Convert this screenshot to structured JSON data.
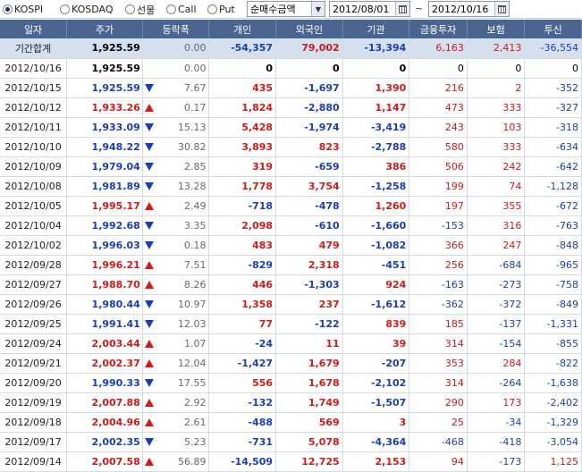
{
  "toolbar": {
    "radios": [
      {
        "label": "KOSPI",
        "selected": true
      },
      {
        "label": "KOSDAQ",
        "selected": false
      },
      {
        "label": "선물",
        "selected": false
      },
      {
        "label": "Call",
        "selected": false
      },
      {
        "label": "Put",
        "selected": false
      }
    ],
    "metric_select": "순매수금액",
    "start_date": "2012/08/01",
    "range_separator": "~",
    "end_date": "2012/10/16"
  },
  "columns": [
    "일자",
    "주가",
    "등락폭",
    "개인",
    "외국인",
    "기관",
    "금융투자",
    "보험",
    "투신"
  ],
  "colors": {
    "up": "#d11a1a",
    "down": "#1b3fb0",
    "header_bg": "#4a6590",
    "summary_bg": "#d5e0ef"
  },
  "rows": [
    {
      "date": "기간합계",
      "price": "1,925.59",
      "dir": "none",
      "change": "0.00",
      "individual": "-54,357",
      "foreign": "79,002",
      "institution": "-13,394",
      "fin_invest": "6,163",
      "insurance": "2,413",
      "trust": "-36,554",
      "summary": true
    },
    {
      "date": "2012/10/16",
      "price": "1,925.59",
      "dir": "none",
      "change": "0.00",
      "individual": "0",
      "foreign": "0",
      "institution": "0",
      "fin_invest": "0",
      "insurance": "0",
      "trust": "0"
    },
    {
      "date": "2012/10/15",
      "price": "1,925.59",
      "dir": "down",
      "change": "7.67",
      "individual": "435",
      "foreign": "-1,697",
      "institution": "1,390",
      "fin_invest": "216",
      "insurance": "2",
      "trust": "-352"
    },
    {
      "date": "2012/10/12",
      "price": "1,933.26",
      "dir": "up",
      "change": "0.17",
      "individual": "1,824",
      "foreign": "-2,880",
      "institution": "1,147",
      "fin_invest": "473",
      "insurance": "333",
      "trust": "-327"
    },
    {
      "date": "2012/10/11",
      "price": "1,933.09",
      "dir": "down",
      "change": "15.13",
      "individual": "5,428",
      "foreign": "-1,974",
      "institution": "-3,419",
      "fin_invest": "243",
      "insurance": "103",
      "trust": "-318"
    },
    {
      "date": "2012/10/10",
      "price": "1,948.22",
      "dir": "down",
      "change": "30.82",
      "individual": "3,893",
      "foreign": "823",
      "institution": "-2,788",
      "fin_invest": "580",
      "insurance": "333",
      "trust": "-634"
    },
    {
      "date": "2012/10/09",
      "price": "1,979.04",
      "dir": "down",
      "change": "2.85",
      "individual": "319",
      "foreign": "-659",
      "institution": "386",
      "fin_invest": "506",
      "insurance": "242",
      "trust": "-642"
    },
    {
      "date": "2012/10/08",
      "price": "1,981.89",
      "dir": "down",
      "change": "13.28",
      "individual": "1,778",
      "foreign": "3,754",
      "institution": "-1,258",
      "fin_invest": "199",
      "insurance": "74",
      "trust": "-1,128"
    },
    {
      "date": "2012/10/05",
      "price": "1,995.17",
      "dir": "up",
      "change": "2.49",
      "individual": "-718",
      "foreign": "-478",
      "institution": "1,260",
      "fin_invest": "197",
      "insurance": "355",
      "trust": "-672"
    },
    {
      "date": "2012/10/04",
      "price": "1,992.68",
      "dir": "down",
      "change": "3.35",
      "individual": "2,098",
      "foreign": "-610",
      "institution": "-1,660",
      "fin_invest": "-153",
      "insurance": "316",
      "trust": "-763"
    },
    {
      "date": "2012/10/02",
      "price": "1,996.03",
      "dir": "down",
      "change": "0.18",
      "individual": "483",
      "foreign": "479",
      "institution": "-1,082",
      "fin_invest": "366",
      "insurance": "247",
      "trust": "-848"
    },
    {
      "date": "2012/09/28",
      "price": "1,996.21",
      "dir": "up",
      "change": "7.51",
      "individual": "-829",
      "foreign": "2,318",
      "institution": "-451",
      "fin_invest": "256",
      "insurance": "-684",
      "trust": "-965"
    },
    {
      "date": "2012/09/27",
      "price": "1,988.70",
      "dir": "up",
      "change": "8.26",
      "individual": "446",
      "foreign": "-1,303",
      "institution": "924",
      "fin_invest": "-163",
      "insurance": "-273",
      "trust": "-758"
    },
    {
      "date": "2012/09/26",
      "price": "1,980.44",
      "dir": "down",
      "change": "10.97",
      "individual": "1,358",
      "foreign": "237",
      "institution": "-1,612",
      "fin_invest": "-362",
      "insurance": "-372",
      "trust": "-849"
    },
    {
      "date": "2012/09/25",
      "price": "1,991.41",
      "dir": "down",
      "change": "12.03",
      "individual": "77",
      "foreign": "-122",
      "institution": "839",
      "fin_invest": "185",
      "insurance": "-137",
      "trust": "-1,331"
    },
    {
      "date": "2012/09/24",
      "price": "2,003.44",
      "dir": "up",
      "change": "1.07",
      "individual": "-24",
      "foreign": "11",
      "institution": "39",
      "fin_invest": "314",
      "insurance": "-154",
      "trust": "-855"
    },
    {
      "date": "2012/09/21",
      "price": "2,002.37",
      "dir": "up",
      "change": "12.04",
      "individual": "-1,427",
      "foreign": "1,679",
      "institution": "-207",
      "fin_invest": "353",
      "insurance": "284",
      "trust": "-822"
    },
    {
      "date": "2012/09/20",
      "price": "1,990.33",
      "dir": "down",
      "change": "17.55",
      "individual": "556",
      "foreign": "1,678",
      "institution": "-2,102",
      "fin_invest": "314",
      "insurance": "-264",
      "trust": "-1,638"
    },
    {
      "date": "2012/09/19",
      "price": "2,007.88",
      "dir": "up",
      "change": "2.92",
      "individual": "-132",
      "foreign": "1,749",
      "institution": "-1,507",
      "fin_invest": "290",
      "insurance": "173",
      "trust": "-2,402"
    },
    {
      "date": "2012/09/18",
      "price": "2,004.96",
      "dir": "up",
      "change": "2.61",
      "individual": "-488",
      "foreign": "569",
      "institution": "3",
      "fin_invest": "25",
      "insurance": "-34",
      "trust": "-1,329"
    },
    {
      "date": "2012/09/17",
      "price": "2,002.35",
      "dir": "down",
      "change": "5.23",
      "individual": "-731",
      "foreign": "5,078",
      "institution": "-4,364",
      "fin_invest": "-468",
      "insurance": "-418",
      "trust": "-3,054"
    },
    {
      "date": "2012/09/14",
      "price": "2,007.58",
      "dir": "up",
      "change": "56.89",
      "individual": "-14,509",
      "foreign": "12,725",
      "institution": "2,153",
      "fin_invest": "94",
      "insurance": "-173",
      "trust": "1,125"
    }
  ]
}
